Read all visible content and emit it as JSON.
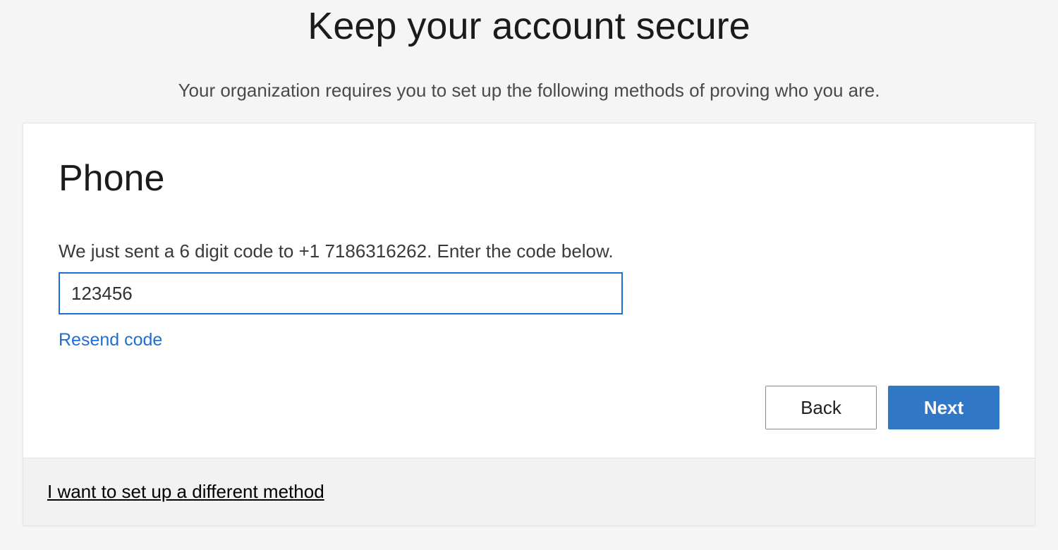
{
  "header": {
    "title": "Keep your account secure",
    "subtitle": "Your organization requires you to set up the following methods of proving who you are."
  },
  "card": {
    "heading": "Phone",
    "instruction": "We just sent a 6 digit code to +1 7186316262. Enter the code below.",
    "code_value": "123456",
    "resend_label": "Resend code",
    "back_label": "Back",
    "next_label": "Next"
  },
  "footer": {
    "different_method_label": "I want to set up a different method"
  }
}
